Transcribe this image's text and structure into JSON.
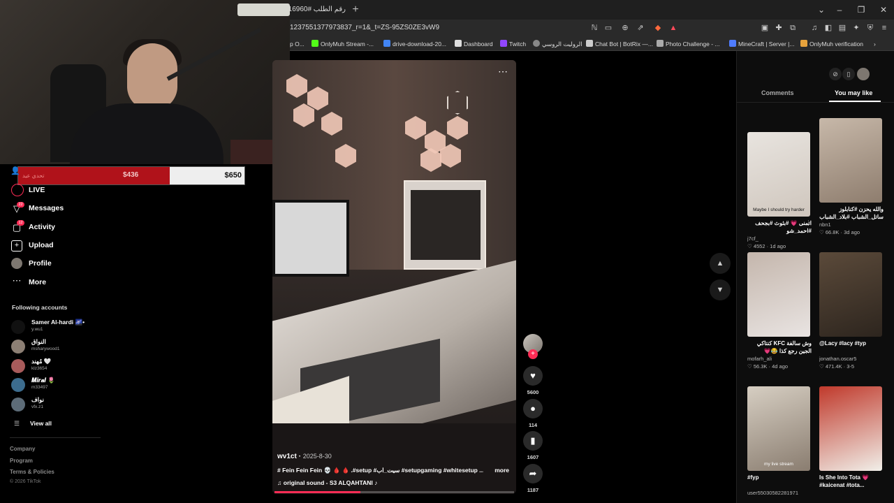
{
  "browser": {
    "tab_title": "رقم الطلب #116960",
    "url": "1237551377973837_r=1&_t=ZS-95ZS0ZE3vW9",
    "bookmarks": [
      {
        "label": "p O...",
        "color": "#555555"
      },
      {
        "label": "OnlyMuh Stream -...",
        "color": "#53fc18"
      },
      {
        "label": "drive-download-20...",
        "color": "#4285f4"
      },
      {
        "label": "Dashboard",
        "color": "#dddddd"
      },
      {
        "label": "Twitch",
        "color": "#9146ff"
      },
      {
        "label": "الروليت الروسي",
        "color": "#888888"
      },
      {
        "label": "Chat Bot | BotRix —...",
        "color": "#cccccc"
      },
      {
        "label": "Photo Challenge - ...",
        "color": "#aaaaaa"
      },
      {
        "label": "MineCraft | Server |...",
        "color": "#4f7cff"
      },
      {
        "label": "OnlyMuh verification",
        "color": "#e6a23c"
      }
    ]
  },
  "donation": {
    "label": "تحدي عيد",
    "current": "$436",
    "goal": "$650",
    "progress": 0.67,
    "fill_color": "#b0121a"
  },
  "sidebar": {
    "items": [
      {
        "label": "LIVE",
        "icon": "live-icon",
        "badge": ""
      },
      {
        "label": "Messages",
        "icon": "messages-icon",
        "badge": "22"
      },
      {
        "label": "Activity",
        "icon": "activity-icon",
        "badge": "12"
      },
      {
        "label": "Upload",
        "icon": "upload-icon",
        "badge": ""
      },
      {
        "label": "Profile",
        "icon": "profile-icon",
        "badge": ""
      },
      {
        "label": "More",
        "icon": "more-icon",
        "badge": ""
      }
    ],
    "following_title": "Following accounts",
    "accounts": [
      {
        "name": "Samer Al-hardi 🌌•",
        "user": "y.wu1"
      },
      {
        "name": "النواق",
        "user": "msharywood1"
      },
      {
        "name": "مُهند 🤍",
        "user": "klz3654"
      },
      {
        "name": "𝑴𝒊𝒓𝒂𝒍 🌷",
        "user": "m33497"
      },
      {
        "name": "نواف",
        "user": "vfx.z1"
      }
    ],
    "view_all": "View all",
    "footer": [
      "Company",
      "Program",
      "Terms & Policies"
    ],
    "copyright": "© 2026 TikTok"
  },
  "video": {
    "author": "wv1ct",
    "date": "2025-8-30",
    "caption": "# Fein Fein Fein 💀 🩸 🩸 .#setup #سيت_اب #setupgaming #whitesetup ...",
    "more": "more",
    "music": "original sound - S3 ALQAHTANI ♪",
    "progress": 0.36,
    "likes": "5600",
    "comments": "114",
    "saves": "1607",
    "shares": "1187"
  },
  "right_panel": {
    "tab_comments": "Comments",
    "tab_you_may_like": "You may like",
    "cards": [
      {
        "thumb_caption": "Maybe I should try harder",
        "title": "اتمنى 💗 #بثوث #بجحف #احمد_شو",
        "user": "j7cf_",
        "likes": "4552",
        "age": "1d ago",
        "colors": [
          "#e8e4df",
          "#cfc6bd"
        ]
      },
      {
        "thumb_caption": "",
        "title": "والله يحزن #كنابلوز ساتل_الشباب #بلاد_الشباب",
        "user": "nbn1",
        "likes": "66.8K",
        "age": "3d ago",
        "colors": [
          "#c7b8a9",
          "#8e7d6e"
        ]
      },
      {
        "thumb_caption": "",
        "title": "وش سالفة KFC كنتاكي الجين رجع كذا 😂💗",
        "user": "mofarh_ali",
        "likes": "56.3K",
        "age": "4d ago",
        "colors": [
          "#c4b6ac",
          "#e9e4e2"
        ]
      },
      {
        "thumb_caption": "",
        "title": "@Lacy #lacy #typ",
        "user": "jonathan.oscar5",
        "likes": "471.4K",
        "age": "3-5",
        "colors": [
          "#5b4a3a",
          "#2d251e"
        ]
      },
      {
        "thumb_caption": "my live stream",
        "title": "#fyp",
        "user": "user55030582281971",
        "likes": "",
        "age": "",
        "colors": [
          "#d6cec2",
          "#8a7d70"
        ]
      },
      {
        "thumb_caption": "",
        "title": "Is She Into Tota 💗 #kaicenat #tota...",
        "user": "",
        "likes": "",
        "age": "",
        "colors": [
          "#c0392b",
          "#f1efe9"
        ]
      }
    ]
  }
}
